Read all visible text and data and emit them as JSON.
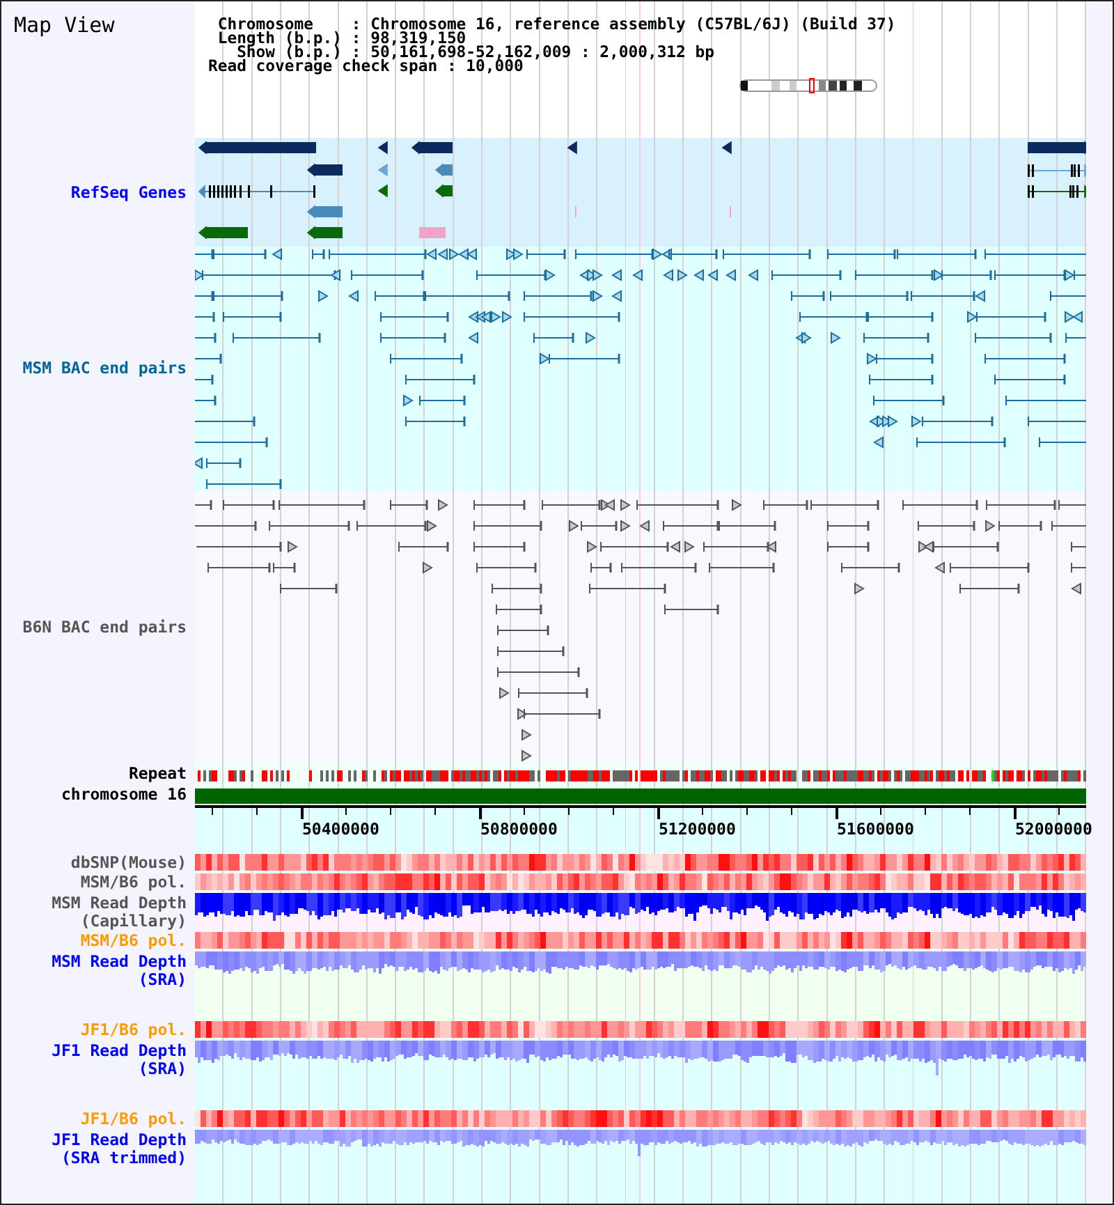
{
  "header": {
    "title": "Map View",
    "info": [
      " Chromosome    : Chromosome 16, reference assembly (C57BL/6J) (Build 37)",
      " Length (b.p.) : 98,319,150",
      "   Show (b.p.) : 50,161,698-52,162,009 : 2,000,312 bp",
      "Read coverage check span : 10,000"
    ]
  },
  "panels": [
    {
      "tracks": [
        {
          "kind": "genes",
          "label": "RefSeq Genes",
          "color": "#0000ff"
        }
      ]
    },
    {
      "tracks": [
        {
          "kind": "msm_bac",
          "label": "MSM BAC end pairs",
          "color": "#006699"
        }
      ]
    },
    {
      "tracks": [
        {
          "kind": "b6n_bac",
          "label": "B6N BAC end pairs",
          "color": "#555555"
        }
      ]
    },
    {
      "tracks": [
        {
          "kind": "repeat",
          "label": "Repeat",
          "color": "#000000"
        },
        {
          "kind": "chromosome",
          "label": "chromosome 16",
          "color": "#000000"
        },
        {
          "kind": "ruler",
          "tick_labels": [
            "50400000",
            "50800000",
            "51200000",
            "51600000",
            "52000000"
          ]
        }
      ]
    },
    {
      "tracks": [
        {
          "kind": "heatmap",
          "label": "dbSNP(Mouse)",
          "color": "#555555"
        },
        {
          "kind": "heatmap",
          "label": "MSM/B6 pol.",
          "color": "#555555"
        }
      ]
    },
    {
      "tracks": [
        {
          "kind": "capillary_depth",
          "label": "MSM Read Depth (Capillary)",
          "color": "#555555"
        }
      ]
    },
    {
      "tracks": [
        {
          "kind": "heatmap",
          "label": "MSM/B6 pol.",
          "color": "#ff9900"
        },
        {
          "kind": "sra_depth",
          "label": "MSM Read Depth (SRA)",
          "color": "#0000ff"
        },
        {
          "kind": "heatmap",
          "label": "JF1/B6 pol.",
          "color": "#ff9900"
        }
      ]
    },
    {
      "tracks": [
        {
          "kind": "sra_depth",
          "label": "JF1 Read Depth (SRA)",
          "color": "#0000ff"
        },
        {
          "kind": "heatmap",
          "label": "JF1/B6 pol.",
          "color": "#ff9900"
        },
        {
          "kind": "trimmed_depth",
          "label": "JF1 Read Depth (SRA trimmed)",
          "color": "#0000ff"
        }
      ]
    }
  ]
}
